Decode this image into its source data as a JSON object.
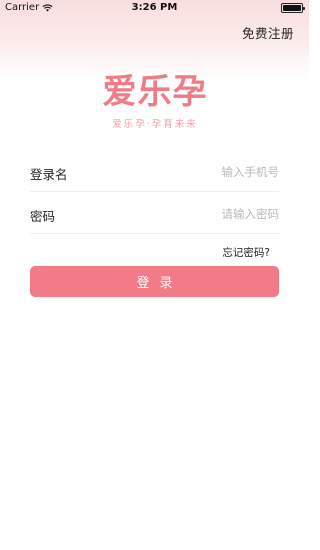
{
  "status_bar": {
    "carrier": "Carrier",
    "wifi_icon": "wifi-icon",
    "time": "3:26 PM",
    "battery_icon": "battery-icon",
    "battery_level": 1.0
  },
  "header": {
    "register_label": "免费注册"
  },
  "logo": {
    "name": "爱乐孕",
    "slogan": "爱乐孕·孕育未来"
  },
  "form": {
    "username": {
      "label": "登录名",
      "placeholder": "输入手机号",
      "value": ""
    },
    "password": {
      "label": "密码",
      "placeholder": "请输入密码",
      "value": ""
    },
    "forgot_label": "忘记密码?",
    "login_label": "登录"
  },
  "colors": {
    "accent": "#f27b87",
    "logo": "#f07b84",
    "header_tint": "#f9dede"
  }
}
